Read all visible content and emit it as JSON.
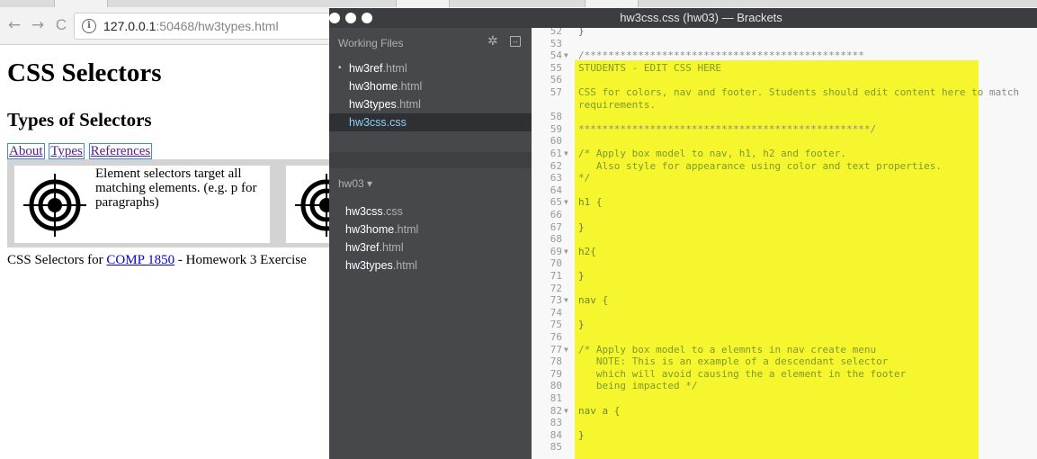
{
  "browser": {
    "back_icon": "←",
    "forward_icon": "→",
    "reload_icon": "C",
    "info_icon": "i",
    "url_host": "127.0.0.1",
    "url_rest": ":50468/hw3types.html"
  },
  "page": {
    "h1": "CSS Selectors",
    "h2": "Types of Selectors",
    "nav": [
      "About",
      "Types",
      "References"
    ],
    "card_text": "Element selectors target all matching elements. (e.g. p for paragraphs)",
    "footer_prefix": "CSS Selectors for ",
    "footer_link": "COMP 1850",
    "footer_suffix": " - Homework 3 Exercise"
  },
  "brackets": {
    "title": "hw3css.css (hw03) — Brackets",
    "working_files_label": "Working Files",
    "working_files": [
      {
        "name": "hw3ref",
        "ext": ".html",
        "dot": "•"
      },
      {
        "name": "hw3home",
        "ext": ".html",
        "dot": ""
      },
      {
        "name": "hw3types",
        "ext": ".html",
        "dot": ""
      },
      {
        "name": "hw3css",
        "ext": ".css",
        "dot": ""
      }
    ],
    "project_label": "hw03 ▾",
    "project_files": [
      {
        "name": "hw3css",
        "ext": ".css"
      },
      {
        "name": "hw3home",
        "ext": ".html"
      },
      {
        "name": "hw3ref",
        "ext": ".html"
      },
      {
        "name": "hw3types",
        "ext": ".html"
      }
    ],
    "code_lines": [
      {
        "n": "52",
        "fold": "",
        "t": "}",
        "cls": "c-brace"
      },
      {
        "n": "53",
        "fold": "",
        "t": "",
        "cls": ""
      },
      {
        "n": "54",
        "fold": "▼",
        "t": "/***********************************************",
        "cls": "c-stars"
      },
      {
        "n": "55",
        "fold": "",
        "t": "STUDENTS - EDIT CSS HERE",
        "cls": "c-comment"
      },
      {
        "n": "56",
        "fold": "",
        "t": "",
        "cls": ""
      },
      {
        "n": "57",
        "fold": "",
        "t": "CSS for colors, nav and footer. Students should edit content here to",
        "cls": "c-comment",
        "overflow": " match"
      },
      {
        "n": "",
        "fold": "",
        "t": "requirements.",
        "cls": "c-comment"
      },
      {
        "n": "58",
        "fold": "",
        "t": "",
        "cls": ""
      },
      {
        "n": "59",
        "fold": "",
        "t": "*************************************************/",
        "cls": "c-stars"
      },
      {
        "n": "60",
        "fold": "",
        "t": "",
        "cls": ""
      },
      {
        "n": "61",
        "fold": "▼",
        "t": "/* Apply box model to nav, h1, h2 and footer.",
        "cls": "c-comment"
      },
      {
        "n": "62",
        "fold": "",
        "t": "   Also style for appearance using color and text properties.",
        "cls": "c-comment"
      },
      {
        "n": "63",
        "fold": "",
        "t": "*/",
        "cls": "c-comment"
      },
      {
        "n": "64",
        "fold": "",
        "t": "",
        "cls": ""
      },
      {
        "n": "65",
        "fold": "▼",
        "t": "h1 {",
        "cls": "c-sel"
      },
      {
        "n": "66",
        "fold": "",
        "t": "",
        "cls": ""
      },
      {
        "n": "67",
        "fold": "",
        "t": "}",
        "cls": "c-brace"
      },
      {
        "n": "68",
        "fold": "",
        "t": "",
        "cls": ""
      },
      {
        "n": "69",
        "fold": "▼",
        "t": "h2{",
        "cls": "c-sel"
      },
      {
        "n": "70",
        "fold": "",
        "t": "",
        "cls": ""
      },
      {
        "n": "71",
        "fold": "",
        "t": "}",
        "cls": "c-brace"
      },
      {
        "n": "72",
        "fold": "",
        "t": "",
        "cls": ""
      },
      {
        "n": "73",
        "fold": "▼",
        "t": "nav {",
        "cls": "c-sel"
      },
      {
        "n": "74",
        "fold": "",
        "t": "",
        "cls": ""
      },
      {
        "n": "75",
        "fold": "",
        "t": "}",
        "cls": "c-brace"
      },
      {
        "n": "76",
        "fold": "",
        "t": "",
        "cls": ""
      },
      {
        "n": "77",
        "fold": "▼",
        "t": "/* Apply box model to a elemnts in nav create menu",
        "cls": "c-comment"
      },
      {
        "n": "78",
        "fold": "",
        "t": "   NOTE: This is an example of a descendant selector",
        "cls": "c-comment"
      },
      {
        "n": "79",
        "fold": "",
        "t": "   which will avoid causing the a element in the footer",
        "cls": "c-comment"
      },
      {
        "n": "80",
        "fold": "",
        "t": "   being impacted */",
        "cls": "c-comment"
      },
      {
        "n": "81",
        "fold": "",
        "t": "",
        "cls": ""
      },
      {
        "n": "82",
        "fold": "▼",
        "t": "nav a {",
        "cls": "c-sel"
      },
      {
        "n": "83",
        "fold": "",
        "t": "",
        "cls": ""
      },
      {
        "n": "84",
        "fold": "",
        "t": "}",
        "cls": "c-brace"
      },
      {
        "n": "85",
        "fold": "",
        "t": "",
        "cls": ""
      }
    ]
  }
}
